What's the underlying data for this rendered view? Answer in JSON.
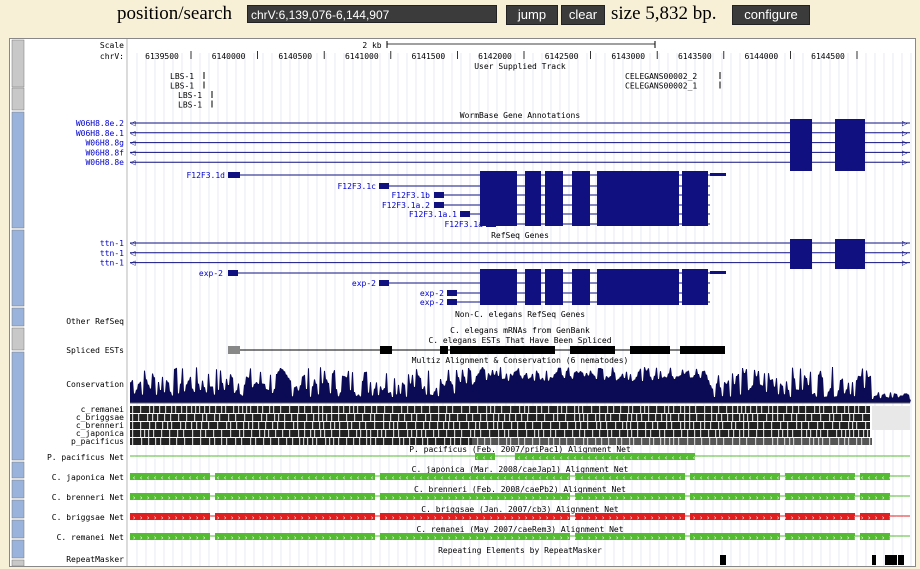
{
  "toolbar": {
    "position_label": "position/search",
    "position_value": "chrV:6,139,076-6,144,907",
    "jump_label": "jump",
    "clear_label": "clear",
    "size_text": "size 5,832 bp.",
    "configure_label": "configure"
  },
  "ruler": {
    "scale_label": "Scale",
    "chrom_label": "chrV:",
    "scale_bar_label": "2 kb",
    "ticks": [
      "6139500",
      "6140000",
      "6140500",
      "6141000",
      "6141500",
      "6142000",
      "6142500",
      "6143000",
      "6143500",
      "6144000",
      "6144500"
    ]
  },
  "user_track": {
    "title": "User Supplied Track",
    "left_items": [
      "LBS-1",
      "LBS-1",
      "LBS-1",
      "LBS-1"
    ],
    "right_items": [
      "CELEGANS00002_2",
      "CELEGANS00002_1"
    ]
  },
  "wormbase": {
    "title": "WormBase Gene Annotations",
    "left_labels": [
      "W06H8.8e.2",
      "W06H8.8e.1",
      "W06H8.8g",
      "W06H8.8f",
      "W06H8.8e"
    ],
    "inline_labels": [
      "F12F3.1d",
      "F12F3.1c",
      "F12F3.1b",
      "F12F3.1a.2",
      "F12F3.1a.1",
      "F12F3.1a"
    ]
  },
  "refseq": {
    "title": "RefSeq Genes",
    "left_labels": [
      "ttn-1",
      "ttn-1",
      "ttn-1"
    ],
    "inline_labels": [
      "exp-2",
      "exp-2",
      "exp-2",
      "exp-2"
    ]
  },
  "non_elegans": {
    "title": "Non-C. elegans RefSeq Genes"
  },
  "other_refseq": {
    "label": "Other RefSeq"
  },
  "mrna": {
    "title": "C. elegans mRNAs from GenBank"
  },
  "spliced_ests": {
    "label": "Spliced ESTs",
    "title": "C. elegans ESTs That Have Been Spliced"
  },
  "conservation": {
    "label": "Conservation",
    "title": "Multiz Alignment & Conservation (6 nematodes)",
    "species": [
      "c_remanei",
      "c_briggsae",
      "c_brenneri",
      "c_japonica",
      "p_pacificus"
    ]
  },
  "nets": [
    {
      "label": "P. pacificus Net",
      "title": "P. pacificus (Feb. 2007/priPac1) Alignment Net"
    },
    {
      "label": "C. japonica Net",
      "title": "C. japonica (Mar. 2008/caeJap1) Alignment Net"
    },
    {
      "label": "C. brenneri Net",
      "title": "C. brenneri (Feb. 2008/caePb2) Alignment Net"
    },
    {
      "label": "C. briggsae Net",
      "title": "C. briggsae (Jan. 2007/cb3) Alignment Net"
    },
    {
      "label": "C. remanei Net",
      "title": "C. remanei (May 2007/caeRem3) Alignment Net"
    }
  ],
  "repeatmasker": {
    "label": "RepeatMasker",
    "title": "Repeating Elements by RepeatMasker"
  },
  "colors": {
    "background": "#f7efd6",
    "gene_blue": "#101080",
    "label_blue": "#0000cc",
    "net_green": "#55bb33",
    "net_red": "#e02020",
    "conservation": "#0b0b55",
    "sidebar_blue": "#9ab3dc",
    "sidebar_gray": "#c8c8c8"
  }
}
